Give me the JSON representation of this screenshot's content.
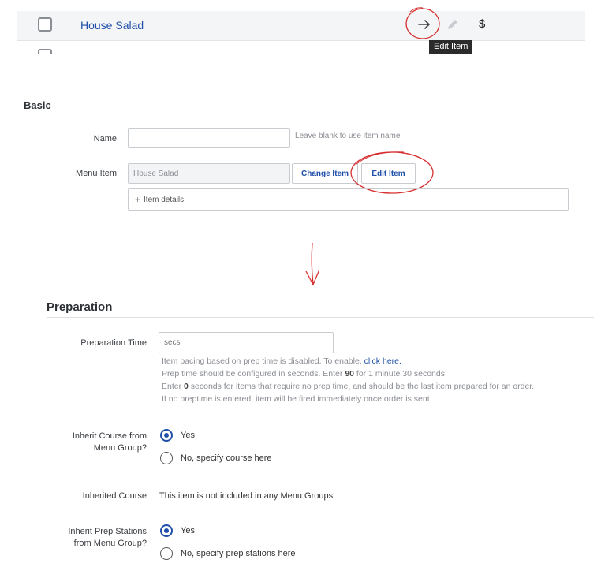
{
  "row": {
    "item_name": "House Salad",
    "dollar_symbol": "$",
    "tooltip": "Edit Item"
  },
  "basic": {
    "title": "Basic",
    "name_label": "Name",
    "name_value": "",
    "name_hint": "Leave blank to use item name",
    "menu_item_label": "Menu Item",
    "menu_item_value": "House Salad",
    "change_item_button": "Change Item",
    "edit_item_button": "Edit Item",
    "item_details": "Item details"
  },
  "preparation": {
    "title": "Preparation",
    "prep_time_label": "Preparation Time",
    "prep_time_placeholder": "secs",
    "help_1_prefix": "Item pacing based on prep time is disabled. To enable, ",
    "help_1_link": "click here.",
    "help_2_prefix": "Prep time should be configured in seconds. Enter ",
    "help_2_bold": "90",
    "help_2_suffix": " for 1 minute 30 seconds.",
    "help_3_prefix": "Enter ",
    "help_3_bold": "0",
    "help_3_suffix": " seconds for items that require no prep time, and should be the last item prepared for an order.",
    "help_4": "If no preptime is entered, item will be fired immediately once order is sent.",
    "inherit_course_label_1": "Inherit Course from",
    "inherit_course_label_2": "Menu Group?",
    "inherit_course_yes": "Yes",
    "inherit_course_no": "No, specify course here",
    "inherited_course_label": "Inherited Course",
    "inherited_course_value": "This item is not included in any Menu Groups",
    "inherit_prep_label_1": "Inherit Prep Stations",
    "inherit_prep_label_2": "from Menu Group?",
    "inherit_prep_yes": "Yes",
    "inherit_prep_no": "No, specify prep stations here"
  },
  "colors": {
    "accent": "#1f4fa8",
    "annotation": "#d62f2f"
  },
  "icons": [
    "arrow-right-icon",
    "pencil-icon",
    "plus-icon",
    "checkbox-icon",
    "radio-icon"
  ]
}
